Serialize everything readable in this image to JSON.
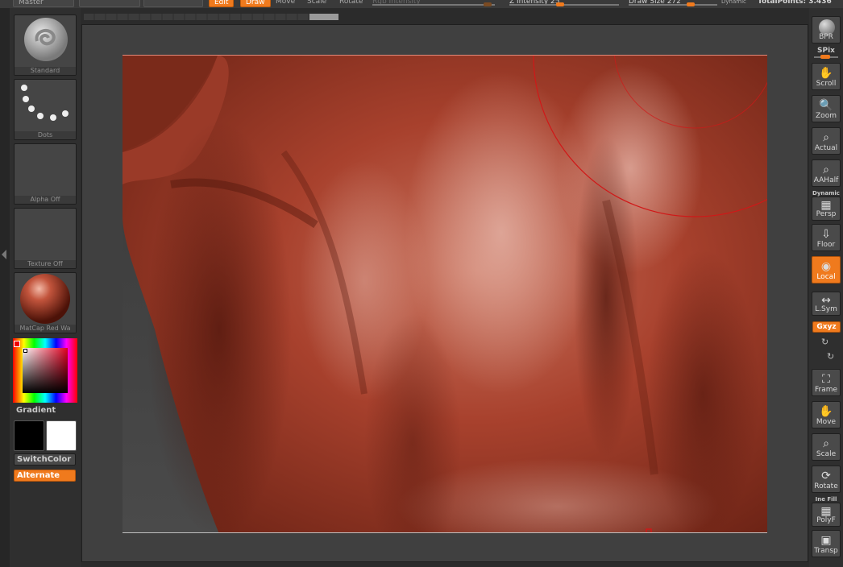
{
  "topbar": {
    "master_label": "Master",
    "edit_label": "Edit",
    "draw_label": "Draw",
    "move_label": "Move",
    "scale_label": "Scale",
    "rotate_label": "Rotate",
    "rgb_intensity_label": "Rgb Intensity",
    "z_intensity_label": "Z Intensity 25",
    "draw_size_label": "Draw Size 272",
    "dynamic_label": "Dynamic",
    "total_points_label": "TotalPoints: 3.436"
  },
  "left_shelf": {
    "brush_caption": "Standard",
    "stroke_caption": "Dots",
    "alpha_caption": "Alpha  Off",
    "texture_caption": "Texture  Off",
    "material_caption": "MatCap  Red  Wa",
    "gradient_label": "Gradient",
    "switch_color_label": "SwitchColor",
    "alternate_label": "Alternate"
  },
  "right_shelf": {
    "bpr_label": "BPR",
    "spix_label": "SPix",
    "scroll_label": "Scroll",
    "zoom_label": "Zoom",
    "actual_label": "Actual",
    "aahalf_label": "AAHalf",
    "dynamic_label": "Dynamic",
    "persp_label": "Persp",
    "floor_label": "Floor",
    "local_label": "Local",
    "lsym_label": "L.Sym",
    "xyz_label": "Gxyz",
    "frame_label": "Frame",
    "move_label": "Move",
    "scale_label": "Scale",
    "rotate_label": "Rotate",
    "line_fill_label": "Ine Fill",
    "polyf_label": "PolyF",
    "transp_label": "Transp"
  },
  "colors": {
    "accent": "#f07a1d",
    "main_color": "#000000",
    "secondary_color": "#ffffff",
    "sculpt_base": "#a8402e",
    "brush_circle": "#d01818"
  }
}
